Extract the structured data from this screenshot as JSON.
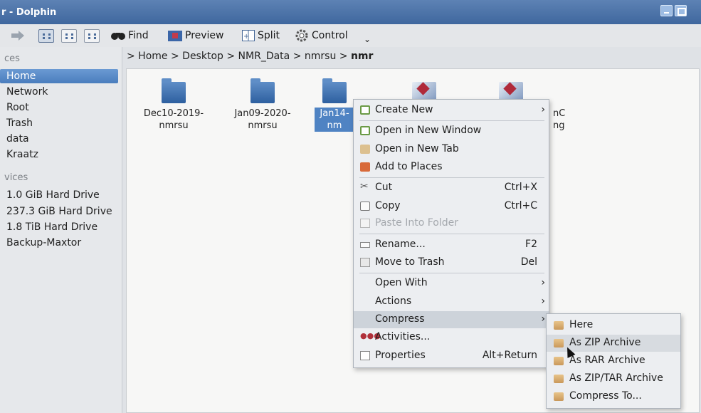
{
  "window": {
    "title": "r - Dolphin"
  },
  "colors": {
    "titlebar": "#4a73aa",
    "selection": "#4f83c3",
    "menu_bg": "#eceef1"
  },
  "toolbar": {
    "find_label": "Find",
    "preview_label": "Preview",
    "split_label": "Split",
    "control_label": "Control",
    "icons": [
      "forward-icon",
      "icons-view-icon",
      "details-view-icon",
      "columns-view-icon",
      "binoculars-icon",
      "preview-icon",
      "split-icon",
      "gear-icon"
    ]
  },
  "sidebar": {
    "places_header": "ces",
    "places": [
      "Home",
      "Network",
      "Root",
      "Trash",
      "data",
      "Kraatz"
    ],
    "devices_header": "vices",
    "devices": [
      "1.0 GiB Hard Drive",
      "237.3 GiB Hard Drive",
      "1.8 TiB Hard Drive",
      "Backup-Maxtor"
    ]
  },
  "breadcrumb": {
    "parts": [
      "> Home",
      "> Desktop",
      "> NMR_Data",
      "> nmrsu",
      ">"
    ],
    "current": "nmr"
  },
  "files": [
    {
      "line1": "Dec10-2019-",
      "line2": "nmrsu",
      "icon": "folder-icon"
    },
    {
      "line1": "Jan09-2020-",
      "line2": "nmrsu",
      "icon": "folder-icon"
    },
    {
      "line1": "Jan14-",
      "line2": "nm",
      "icon": "folder-icon"
    },
    {
      "line1": "",
      "line2": "",
      "icon": "document-icon"
    },
    {
      "line1": "nC",
      "line2": "ng",
      "icon": "document-icon"
    }
  ],
  "context_menu": {
    "create_new": "Create New",
    "open_new_window": "Open in New Window",
    "open_new_tab": "Open in New Tab",
    "add_to_places": "Add to Places",
    "cut": "Cut",
    "cut_shortcut": "Ctrl+X",
    "copy": "Copy",
    "copy_shortcut": "Ctrl+C",
    "paste": "Paste Into Folder",
    "rename": "Rename...",
    "rename_shortcut": "F2",
    "trash": "Move to Trash",
    "trash_shortcut": "Del",
    "open_with": "Open With",
    "actions": "Actions",
    "compress": "Compress",
    "activities": "Activities...",
    "properties": "Properties",
    "properties_shortcut": "Alt+Return"
  },
  "compress_submenu": {
    "here": "Here",
    "zip": "As ZIP Archive",
    "rar": "As RAR Archive",
    "ziptar": "As ZIP/TAR Archive",
    "to": "Compress To..."
  }
}
